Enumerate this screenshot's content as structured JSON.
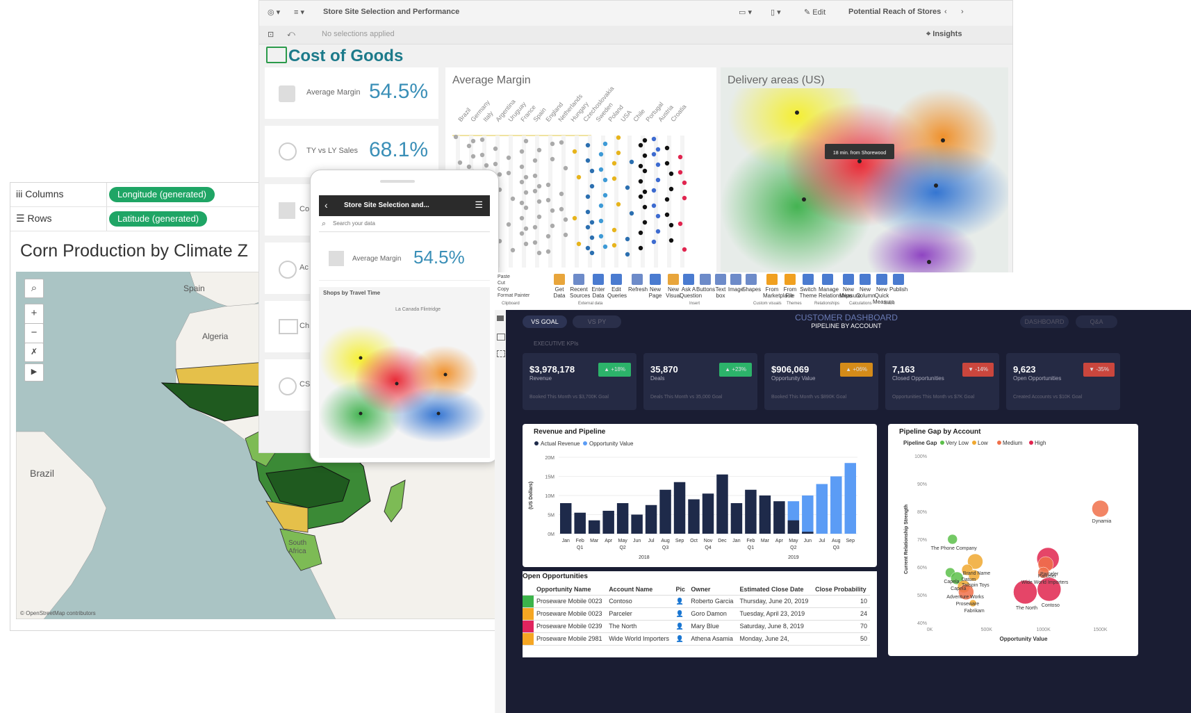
{
  "tableau": {
    "columns_label": "Columns",
    "rows_label": "Rows",
    "columns_pill": "Longitude (generated)",
    "rows_pill": "Latitude (generated)",
    "title": "Corn Production by Climate Z",
    "map_labels": {
      "spain": "Spain",
      "algeria": "Algeria",
      "brazil": "Brazil",
      "south_africa_1": "South",
      "south_africa_2": "Africa"
    },
    "attribution": "© OpenStreetMap contributors",
    "colors": {
      "pill": "#1fa565",
      "sea": "#aac4c4",
      "land": "#f3f1ec",
      "zone_yellow": "#e5c04a",
      "zone_dark": "#1f5a1f",
      "zone_mid": "#3b8a36",
      "zone_light": "#7dbb55"
    }
  },
  "qlik": {
    "app_title": "Store Site Selection and Performance",
    "edit_label": "Edit",
    "sheet_selector": "Potential Reach of Stores",
    "selections_text": "No selections applied",
    "insights_label": "Insights",
    "sheet_title": "Cost of Goods",
    "kpis": [
      {
        "label": "Average Margin",
        "value": "54.5%"
      },
      {
        "label": "TY vs LY Sales",
        "value": "68.1%"
      },
      {
        "label": "Co",
        "value": ""
      },
      {
        "label": "Ac",
        "value": ""
      },
      {
        "label": "Ch",
        "value": ""
      },
      {
        "label": "CSA",
        "value": ""
      }
    ],
    "avg_margin_chart": {
      "title": "Average Margin",
      "countries": [
        "Brazil",
        "Germany",
        "Italy",
        "Argentina",
        "Uruguay",
        "France",
        "Spain",
        "England",
        "Netherlands",
        "Hungary",
        "Czechoslovakia",
        "Sweden",
        "Poland",
        "USA",
        "Chile",
        "Portugal",
        "Austria",
        "Croatia"
      ]
    },
    "delivery_map": {
      "title": "Delivery areas (US)",
      "tooltip": "18 min. from Shorewood"
    },
    "colors": {
      "accent": "#1c7a8a",
      "kpi_value": "#3a8fb7"
    }
  },
  "mobile": {
    "header": "Store Site Selection and...",
    "search_placeholder": "Search your data",
    "kpi_label": "Average Margin",
    "kpi_value": "54.5%",
    "map_title": "Shops by Travel Time",
    "map_place": "La Canada Flintridge"
  },
  "powerbi": {
    "ribbon": {
      "clipboard": [
        "Paste",
        "Cut",
        "Copy",
        "Format Painter"
      ],
      "buttons": [
        {
          "label": "Get Data"
        },
        {
          "label": "Recent Sources"
        },
        {
          "label": "Enter Data"
        },
        {
          "label": "Edit Queries"
        },
        {
          "label": "Refresh"
        },
        {
          "label": "New Page"
        },
        {
          "label": "New Visual"
        },
        {
          "label": "Ask A Question"
        },
        {
          "label": "Buttons"
        },
        {
          "label": "Text box"
        },
        {
          "label": "Image"
        },
        {
          "label": "Shapes"
        },
        {
          "label": "From Marketplace"
        },
        {
          "label": "From File"
        },
        {
          "label": "Switch Theme"
        },
        {
          "label": "Manage Relationships"
        },
        {
          "label": "New Measure"
        },
        {
          "label": "New Column"
        },
        {
          "label": "New Quick Measure"
        },
        {
          "label": "Publish"
        }
      ],
      "groups": [
        "Clipboard",
        "External data",
        "Insert",
        "Custom visuals",
        "Themes",
        "Relationships",
        "Calculations",
        "Share"
      ]
    },
    "tabs": {
      "vs_goal": "VS GOAL",
      "vs_py": "VS PY",
      "dashboard": "DASHBOARD",
      "qa": "Q&A"
    },
    "header_title": "CUSTOMER DASHBOARD",
    "header_subtitle": "PIPELINE BY ACCOUNT",
    "section_label": "EXECUTIVE KPIs",
    "kpis": [
      {
        "value": "$3,978,178",
        "label": "Revenue",
        "badge": "▲ +18%",
        "footer": "Booked This Month vs $3,700K Goal",
        "badge_color": "#2ecc71"
      },
      {
        "value": "35,870",
        "label": "Deals",
        "badge": "▲ +23%",
        "footer": "Deals This Month vs 35,000 Goal",
        "badge_color": "#2ecc71"
      },
      {
        "value": "$906,069",
        "label": "Opportunity Value",
        "badge": "▲ +06%",
        "footer": "Booked This Month vs $890K Goal",
        "badge_color": "#f39c12"
      },
      {
        "value": "7,163",
        "label": "Closed Opportunities",
        "badge": "▼ -14%",
        "footer": "Opportunities This Month vs $7K Goal",
        "badge_color": "#e74c3c"
      },
      {
        "value": "9,623",
        "label": "Open Opportunities",
        "badge": "▼ -35%",
        "footer": "Created Accounts vs $10K Goal",
        "badge_color": "#e74c3c"
      }
    ],
    "opportunities": {
      "title": "Open Opportunities",
      "headers": [
        "Opportunity Name",
        "Account Name",
        "Pic",
        "Owner",
        "Estimated Close Date",
        "Close Probability"
      ],
      "rows": [
        {
          "color": "#3cb44b",
          "name": "Proseware Mobile 0023",
          "account": "Contoso",
          "owner": "Roberto Garcia",
          "date": "Thursday, June 20, 2019",
          "prob": "10"
        },
        {
          "color": "#f5a623",
          "name": "Proseware Mobile 0023",
          "account": "Parceler",
          "owner": "Goro Damon",
          "date": "Tuesday, April 23, 2019",
          "prob": "24"
        },
        {
          "color": "#e0245e",
          "name": "Proseware Mobile 0239",
          "account": "The North",
          "owner": "Mary Blue",
          "date": "Saturday, June 8, 2019",
          "prob": "70"
        },
        {
          "color": "#f5a623",
          "name": "Proseware Mobile 2981",
          "account": "Wide World Importers",
          "owner": "Athena Asamia",
          "date": "Monday, June 24,",
          "prob": "50"
        }
      ]
    }
  },
  "chart_data": [
    {
      "type": "bar",
      "title": "Revenue and Pipeline",
      "legend": [
        "Actual Revenue",
        "Opportunity Value"
      ],
      "colors": {
        "Actual Revenue": "#1e2a4a",
        "Opportunity Value": "#5b9cf5"
      },
      "ylabel": "(US Dollars)",
      "ylim": [
        0,
        20
      ],
      "yticks": [
        "0M",
        "5M",
        "10M",
        "15M",
        "20M"
      ],
      "categories": [
        "Jan",
        "Feb",
        "Mar",
        "Apr",
        "May",
        "Jun",
        "Jul",
        "Aug",
        "Sep",
        "Oct",
        "Nov",
        "Dec",
        "Jan",
        "Feb",
        "Mar",
        "Apr",
        "May",
        "Jun",
        "Jul",
        "Aug",
        "Sep"
      ],
      "quarters": [
        "Q1",
        "Q2",
        "Q3",
        "Q4",
        "Q1",
        "Q2",
        "Q3"
      ],
      "years": [
        "2018",
        "2019"
      ],
      "series": [
        {
          "name": "Actual Revenue",
          "values": [
            8,
            5.5,
            3.5,
            6,
            8,
            5,
            7.5,
            11.5,
            13.5,
            9,
            10.5,
            15.5,
            8,
            11.5,
            10,
            8.5,
            3.5,
            0.5,
            0,
            0,
            0
          ]
        },
        {
          "name": "Opportunity Value",
          "values": [
            0,
            0,
            0,
            0,
            0,
            0,
            0,
            0,
            0,
            0,
            0,
            0,
            0,
            0,
            0,
            0,
            8.5,
            10,
            13,
            15,
            18.5
          ]
        }
      ],
      "legend_placement": "top-left"
    },
    {
      "type": "scatter",
      "title": "Pipeline Gap by Account",
      "legend_title": "Pipeline Gap",
      "legend": [
        "Very Low",
        "Low",
        "Medium",
        "High"
      ],
      "colors": {
        "Very Low": "#5cbf4a",
        "Low": "#f0a830",
        "Medium": "#f0704a",
        "High": "#e0244e"
      },
      "xlabel": "Opportunity Value",
      "ylabel": "Current Relationship Strength",
      "xlim": [
        0,
        1650
      ],
      "ylim": [
        40,
        100
      ],
      "xticks": [
        "0K",
        "500K",
        "1000K",
        "1500K"
      ],
      "yticks": [
        "40%",
        "50%",
        "60%",
        "70%",
        "80%",
        "90%",
        "100%"
      ],
      "points": [
        {
          "label": "Dynamia",
          "x": 1500,
          "y": 81,
          "size": 24,
          "gap": "Medium"
        },
        {
          "label": "The Phone Company",
          "x": 200,
          "y": 70,
          "size": 14,
          "gap": "Very Low"
        },
        {
          "label": "Parceler",
          "x": 1040,
          "y": 63,
          "size": 32,
          "gap": "High"
        },
        {
          "label": "Parceler",
          "x": 1020,
          "y": 61,
          "size": 22,
          "gap": "Medium"
        },
        {
          "label": "Wide World Importers",
          "x": 1000,
          "y": 58,
          "size": 16,
          "gap": "Medium"
        },
        {
          "label": "Contoso",
          "x": 1050,
          "y": 52,
          "size": 34,
          "gap": "High"
        },
        {
          "label": "The North",
          "x": 840,
          "y": 51,
          "size": 34,
          "gap": "High"
        },
        {
          "label": "Brand Name",
          "x": 400,
          "y": 62,
          "size": 22,
          "gap": "Low"
        },
        {
          "label": "Datum",
          "x": 330,
          "y": 59,
          "size": 16,
          "gap": "Low"
        },
        {
          "label": "Tailspin Toys",
          "x": 390,
          "y": 57,
          "size": 16,
          "gap": "Low"
        },
        {
          "label": "Capela",
          "x": 180,
          "y": 58,
          "size": 14,
          "gap": "Very Low"
        },
        {
          "label": "Capela",
          "x": 240,
          "y": 56,
          "size": 18,
          "gap": "Very Low"
        },
        {
          "label": "Adventure Works",
          "x": 300,
          "y": 53,
          "size": 18,
          "gap": "Low"
        },
        {
          "label": "Proseware",
          "x": 320,
          "y": 51,
          "size": 22,
          "gap": "Medium"
        },
        {
          "label": "Fabrikam",
          "x": 380,
          "y": 47,
          "size": 10,
          "gap": "Low"
        }
      ]
    }
  ]
}
